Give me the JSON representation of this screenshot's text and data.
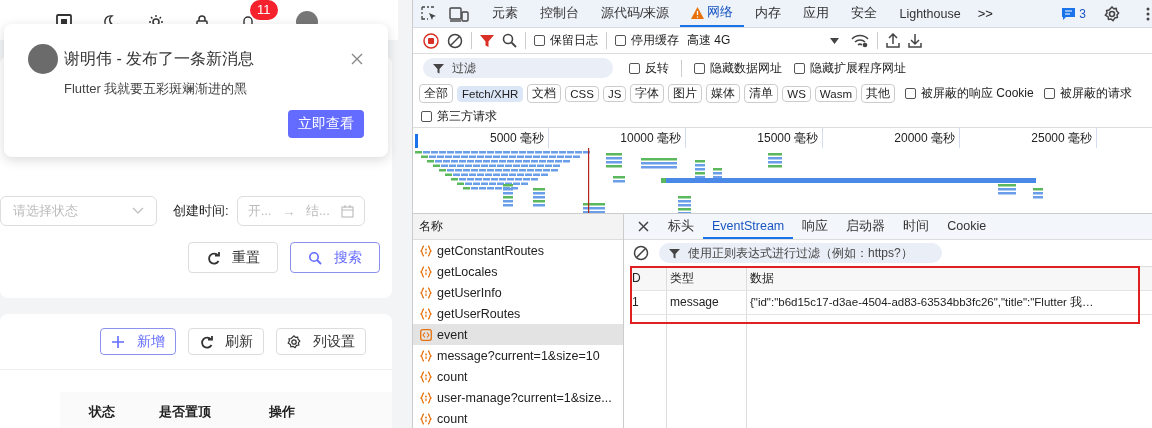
{
  "app": {
    "header": {
      "badge": "11"
    },
    "notification": {
      "title": "谢明伟 - 发布了一条新消息",
      "message": "Flutter 我就要五彩斑斓渐进的黑",
      "action": "立即查看"
    },
    "search_form": {
      "status_select": {
        "placeholder": "请选择状态"
      },
      "date_label": "创建时间:",
      "date_range": {
        "start_placeholder": "开...",
        "separator": "→",
        "end_placeholder": "结..."
      },
      "buttons": [
        {
          "label": "重置",
          "kind": "reset"
        },
        {
          "label": "搜索",
          "kind": "search"
        }
      ]
    },
    "toolbar_buttons": [
      {
        "label": "新增",
        "kind": "add"
      },
      {
        "label": "刷新",
        "kind": "refresh"
      },
      {
        "label": "列设置",
        "kind": "settings"
      }
    ],
    "table": {
      "columns": [
        "状态",
        "是否置顶",
        "操作"
      ]
    }
  },
  "devtools": {
    "tabs": [
      {
        "label": "元素",
        "selected": false,
        "warning": false
      },
      {
        "label": "控制台",
        "selected": false,
        "warning": false
      },
      {
        "label": "源代码/来源",
        "selected": false,
        "warning": false
      },
      {
        "label": "网络",
        "selected": true,
        "warning": true
      },
      {
        "label": "内存",
        "selected": false,
        "warning": false
      },
      {
        "label": "应用",
        "selected": false,
        "warning": false
      },
      {
        "label": "安全",
        "selected": false,
        "warning": false
      },
      {
        "label": "Lighthouse",
        "selected": false,
        "warning": false
      }
    ],
    "more_tabs": ">>",
    "issues_count": "3",
    "toolbar": {
      "recording": true,
      "filter_active": true,
      "preserve_log": {
        "label": "保留日志",
        "checked": false
      },
      "disable_cache": {
        "label": "停用缓存",
        "checked": false
      },
      "throttling": "高速 4G"
    },
    "filter": {
      "placeholder": "过滤",
      "options": [
        {
          "label": "反转",
          "checked": false
        },
        {
          "label": "隐藏数据网址",
          "checked": false
        },
        {
          "label": "隐藏扩展程序网址",
          "checked": false
        }
      ]
    },
    "type_filters": [
      {
        "label": "全部",
        "selected": false
      },
      {
        "label": "Fetch/XHR",
        "selected": true
      },
      {
        "label": "文档",
        "selected": false
      },
      {
        "label": "CSS",
        "selected": false
      },
      {
        "label": "JS",
        "selected": false
      },
      {
        "label": "字体",
        "selected": false
      },
      {
        "label": "图片",
        "selected": false
      },
      {
        "label": "媒体",
        "selected": false
      },
      {
        "label": "清单",
        "selected": false
      },
      {
        "label": "WS",
        "selected": false
      },
      {
        "label": "Wasm",
        "selected": false
      },
      {
        "label": "其他",
        "selected": false
      }
    ],
    "blocked_options": [
      {
        "label": "被屏蔽的响应 Cookie",
        "checked": false
      },
      {
        "label": "被屏蔽的请求",
        "checked": false
      }
    ],
    "third_party": {
      "label": "第三方请求",
      "checked": false
    },
    "overview": {
      "ticks": [
        "5000 毫秒",
        "10000 毫秒",
        "15000 毫秒",
        "20000 毫秒",
        "25000 毫秒"
      ]
    },
    "requests": {
      "header": "名称",
      "items": [
        {
          "name": "getConstantRoutes",
          "kind": "fetch",
          "selected": false
        },
        {
          "name": "getLocales",
          "kind": "fetch",
          "selected": false
        },
        {
          "name": "getUserInfo",
          "kind": "fetch",
          "selected": false
        },
        {
          "name": "getUserRoutes",
          "kind": "fetch",
          "selected": false
        },
        {
          "name": "event",
          "kind": "eventsource",
          "selected": true
        },
        {
          "name": "message?current=1&size=10",
          "kind": "fetch",
          "selected": false
        },
        {
          "name": "count",
          "kind": "fetch",
          "selected": false
        },
        {
          "name": "user-manage?current=1&size...",
          "kind": "fetch",
          "selected": false
        },
        {
          "name": "count",
          "kind": "fetch",
          "selected": false
        }
      ]
    },
    "detail": {
      "tabs": [
        {
          "label": "标头",
          "selected": false
        },
        {
          "label": "EventStream",
          "selected": true
        },
        {
          "label": "响应",
          "selected": false
        },
        {
          "label": "启动器",
          "selected": false
        },
        {
          "label": "时间",
          "selected": false
        },
        {
          "label": "Cookie",
          "selected": false
        }
      ],
      "filter_placeholder": "使用正则表达式进行过滤（例如：https?）",
      "table": {
        "columns": [
          "D",
          "类型",
          "数据"
        ],
        "rows": [
          [
            "1",
            "message",
            "{\"id\":\"b6d15c17-d3ae-4504-ad83-63534bb3fc26\",\"title\":\"Flutter 我…"
          ]
        ]
      },
      "highlighted": true
    }
  }
}
